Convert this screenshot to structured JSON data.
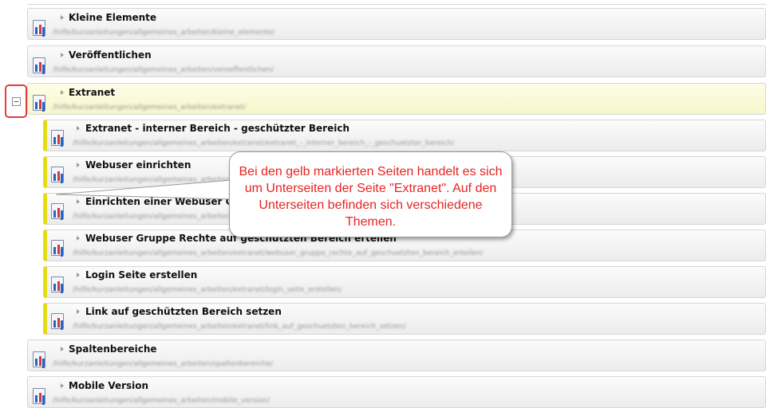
{
  "rows": [
    {
      "title": "Kleine Elemente",
      "path": "/hilfe/kurzanleitungen/allgemeines_arbeiten/kleine_elemente/"
    },
    {
      "title": "Veröffentlichen",
      "path": "/hilfe/kurzanleitungen/allgemeines_arbeiten/veroeffentlichen/"
    },
    {
      "title": "Extranet",
      "path": "/hilfe/kurzanleitungen/allgemeines_arbeiten/extranet/"
    },
    {
      "title": "Extranet - interner Bereich - geschützter Bereich",
      "path": "/hilfe/kurzanleitungen/allgemeines_arbeiten/extranet/extranet_-_interner_bereich_-_geschuetzter_bereich/"
    },
    {
      "title": "Webuser einrichten",
      "path": "/hilfe/kurzanleitungen/allgemeines_arbeiten/extranet/webuser_einrichten/"
    },
    {
      "title": "Einrichten einer Webuser Gruppe",
      "path": "/hilfe/kurzanleitungen/allgemeines_arbeiten/extranet/einrichten_einer_webuser_gruppe/"
    },
    {
      "title": "Webuser Gruppe Rechte auf geschützten Bereich erteilen",
      "path": "/hilfe/kurzanleitungen/allgemeines_arbeiten/extranet/webuser_gruppe_rechte_auf_geschuetzten_bereich_erteilen/"
    },
    {
      "title": "Login Seite erstellen",
      "path": "/hilfe/kurzanleitungen/allgemeines_arbeiten/extranet/login_seite_erstellen/"
    },
    {
      "title": "Link auf geschützten Bereich setzen",
      "path": "/hilfe/kurzanleitungen/allgemeines_arbeiten/extranet/link_auf_geschuetzten_bereich_setzen/"
    },
    {
      "title": "Spaltenbereiche",
      "path": "/hilfe/kurzanleitungen/allgemeines_arbeiten/spaltenbereiche/"
    },
    {
      "title": "Mobile Version",
      "path": "/hilfe/kurzanleitungen/allgemeines_arbeiten/mobile_version/"
    }
  ],
  "callout": {
    "text": "Bei den gelb markierten Seiten handelt es sich um Unterseiten der Seite \"Extranet\". Auf den Unterseiten befinden sich verschiedene Themen."
  },
  "colors": {
    "highlight": "#e6dc14",
    "callout_text": "#e8231f",
    "callout_frame": "#e33c3c"
  },
  "icons": {
    "page": "page-icon",
    "expand": "triangle-right-icon",
    "collapse": "collapse-minus-icon"
  }
}
